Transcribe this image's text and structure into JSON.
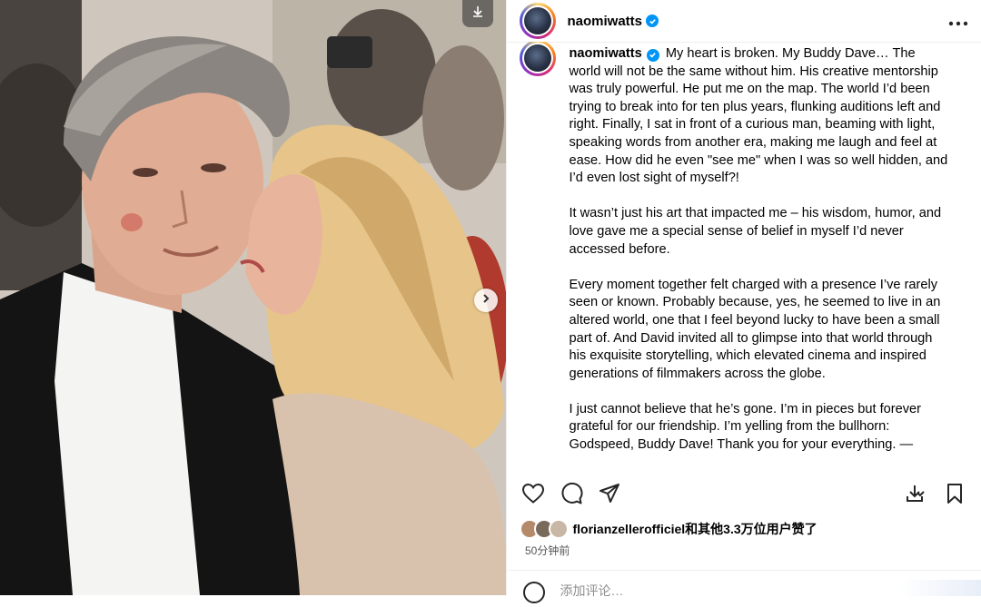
{
  "post": {
    "username": "naomiwatts",
    "verified": true,
    "caption_username": "naomiwatts",
    "caption_paragraphs": [
      "My heart is broken. My Buddy Dave… The world will not be the same without him. His creative mentorship was truly powerful. He put me on the map. The world I’d been trying to break into for ten plus years, flunking auditions left and right. Finally, I sat in front of a curious man, beaming with light, speaking words from another era, making me laugh and feel at ease. How did he even \"see me\" when I was so well hidden, and I’d even lost sight of myself?!",
      "It wasn’t just his art that impacted me – his wisdom, humor, and love gave me a special sense of belief in myself I’d never accessed before.",
      "Every moment together felt charged with a presence I’ve rarely seen or known. Probably because, yes, he seemed to live in an altered world, one that I feel beyond lucky to have been a small part of. And David invited all to glimpse into that world through his exquisite storytelling, which elevated cinema and inspired generations of filmmakers across the globe.",
      "I just cannot believe that he’s gone. I’m in pieces but forever grateful for our friendship.  I’m yelling from the bullhorn: Godspeed, Buddy Dave! Thank you for your everything.  —"
    ],
    "likes_text": "florianzellerofficiel和其他3.3万位用户赞了",
    "time_ago": "50分钟前",
    "comment_placeholder": "添加评论…"
  },
  "icons": {
    "more": "more-options-icon",
    "like": "heart-icon",
    "comment": "comment-icon",
    "share": "send-icon",
    "download": "download-icon",
    "save": "bookmark-icon",
    "emoji": "emoji-icon",
    "next": "chevron-right-icon",
    "photo_save": "download-icon"
  },
  "colors": {
    "verified": "#0095f6",
    "text": "#000000",
    "secondary": "#737373",
    "border": "#efefef"
  }
}
